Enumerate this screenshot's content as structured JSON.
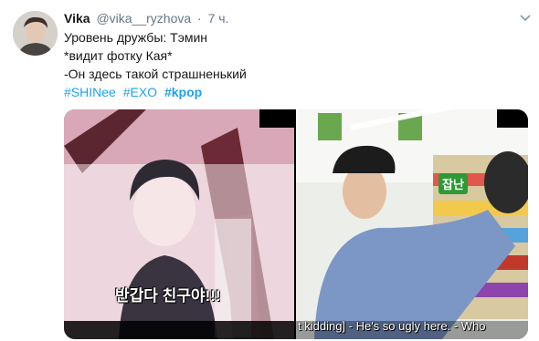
{
  "user": {
    "name": "Vika",
    "handle": "@vika__ryzhova",
    "separator": "·",
    "time": "7 ч."
  },
  "tweet": {
    "lines": [
      "Уровень дружбы: Тэмин",
      "*видит фотку Кая*",
      "-Он здесь такой страшненький"
    ],
    "hashtags": [
      "#SHINee",
      "#EXO",
      "#kpop"
    ]
  },
  "media": {
    "left_overlay_text": "반갑다 친구야!!!",
    "right_sign_text": "잡난",
    "subtitle": "t kidding] - He's so ugly here. - Who"
  },
  "colors": {
    "link": "#1da1f2",
    "secondary_text": "#657786",
    "primary_text": "#14171a"
  },
  "icons": {
    "more": "chevron-down-icon"
  }
}
